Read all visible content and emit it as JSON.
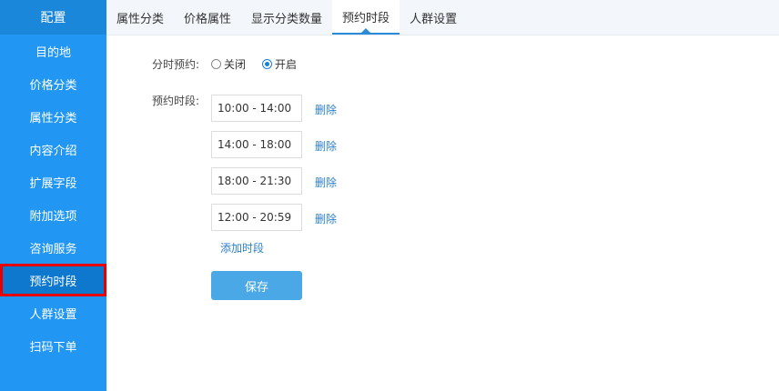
{
  "sidebar": {
    "title": "配置",
    "items": [
      {
        "label": "目的地"
      },
      {
        "label": "价格分类"
      },
      {
        "label": "属性分类"
      },
      {
        "label": "内容介绍"
      },
      {
        "label": "扩展字段"
      },
      {
        "label": "附加选项"
      },
      {
        "label": "咨询服务"
      },
      {
        "label": "预约时段",
        "active": true
      },
      {
        "label": "人群设置"
      },
      {
        "label": "扫码下单"
      }
    ]
  },
  "tabs": [
    {
      "label": "属性分类"
    },
    {
      "label": "价格属性"
    },
    {
      "label": "显示分类数量"
    },
    {
      "label": "预约时段",
      "active": true
    },
    {
      "label": "人群设置"
    }
  ],
  "form": {
    "timed_booking_label": "分时预约:",
    "radio_off_label": "关闭",
    "radio_on_label": "开启",
    "selected": "on",
    "slots_label": "预约时段:",
    "slots": [
      {
        "value": "10:00 - 14:00",
        "delete_label": "删除"
      },
      {
        "value": "14:00 - 18:00",
        "delete_label": "删除"
      },
      {
        "value": "18:00 - 21:30",
        "delete_label": "删除"
      },
      {
        "value": "12:00 - 20:59",
        "delete_label": "删除"
      }
    ],
    "add_slot_label": "添加时段",
    "save_label": "保存"
  },
  "colors": {
    "sidebar_bg": "#2196f3",
    "sidebar_active_bg": "#0e78cf",
    "highlight_outline": "#e60000",
    "link": "#2b7fd0",
    "save_button": "#49a8e5"
  }
}
